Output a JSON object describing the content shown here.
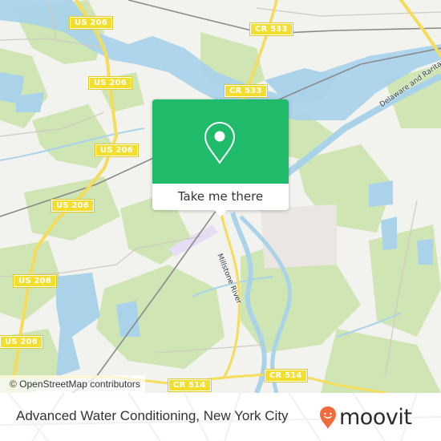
{
  "map": {
    "road_shields": [
      {
        "label": "US 206"
      },
      {
        "label": "US 206"
      },
      {
        "label": "US 206"
      },
      {
        "label": "US 206"
      },
      {
        "label": "US 206"
      },
      {
        "label": "US 206"
      },
      {
        "label": "CR 533"
      },
      {
        "label": "CR 533"
      },
      {
        "label": "CR 514"
      },
      {
        "label": "CR 514"
      }
    ],
    "water_labels": [
      {
        "label": "Millstone River"
      },
      {
        "label": "Delaware and Raritan C..."
      }
    ],
    "attribution": "© OpenStreetMap contributors",
    "colors": {
      "land": "#f2f2ee",
      "forest": "#cfe6b4",
      "water": "#aad3ea",
      "road_major": "#f5dc5a",
      "rail": "#888888"
    }
  },
  "popup": {
    "icon": "map-pin-icon",
    "button_label": "Take me there",
    "color": "#1fba6a"
  },
  "footer": {
    "place_title": "Advanced Water Conditioning, New York City",
    "logo_text": "moovit",
    "logo_icon": "moovit-pin-smile-icon",
    "logo_color": "#f26b3a"
  }
}
